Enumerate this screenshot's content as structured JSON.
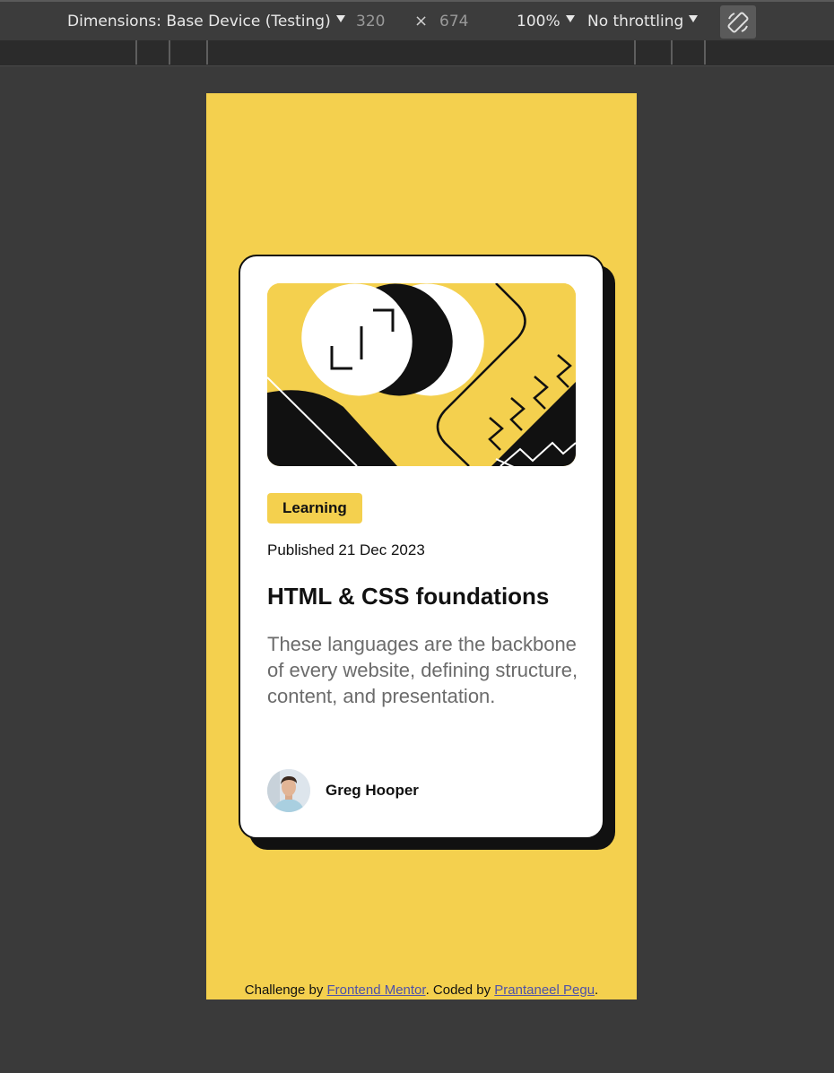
{
  "devtools": {
    "dimensions_label": "Dimensions: Base Device (Testing)",
    "width": "320",
    "times": "×",
    "height": "674",
    "zoom": "100%",
    "throttling": "No throttling"
  },
  "card": {
    "tag": "Learning",
    "published": "Published 21 Dec 2023",
    "title": "HTML & CSS foundations",
    "description": "These languages are the backbone of every website, defining structure, content, and presentation.",
    "author": "Greg Hooper"
  },
  "footer": {
    "prefix": "Challenge by ",
    "link1": "Frontend Mentor",
    "middle": ". Coded by ",
    "link2": "Prantaneel Pegu",
    "suffix": "."
  },
  "colors": {
    "accent": "#f4d04e",
    "dark": "#111111",
    "muted_text": "#6b6b6b",
    "link": "#4f52a8"
  }
}
